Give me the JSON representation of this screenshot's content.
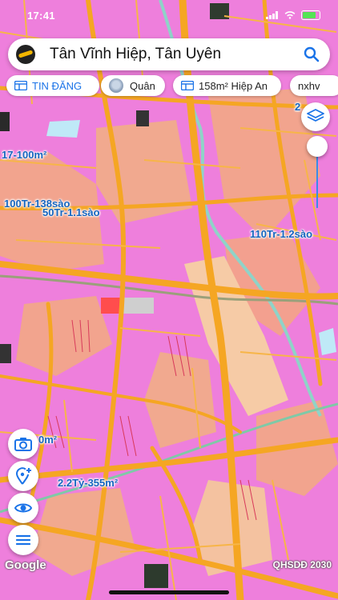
{
  "status": {
    "time": "17:41"
  },
  "search": {
    "query": "Tân Vĩnh Hiệp, Tân Uyên"
  },
  "chips": [
    {
      "label": "TIN ĐĂNG"
    },
    {
      "label": "Quân"
    },
    {
      "label": "158m² Hiệp An"
    },
    {
      "label": "nxhv"
    }
  ],
  "map_labels": {
    "l1": "17-100m²",
    "l2": "100Tr-138sào",
    "l3": "50Tr-1.1sào",
    "l4": "110Tr-1.2sào",
    "l5": "0m²",
    "l6": "2.2Tỷ-355m²",
    "l7": "2"
  },
  "footer": {
    "brand": "Google",
    "layer": "QHSDĐ 2030"
  },
  "colors": {
    "accent": "#1a73e8",
    "road": "#f5a623",
    "residential": "#ee7fdc",
    "agri": "#f4c6a0",
    "river": "#8fd3c8"
  }
}
